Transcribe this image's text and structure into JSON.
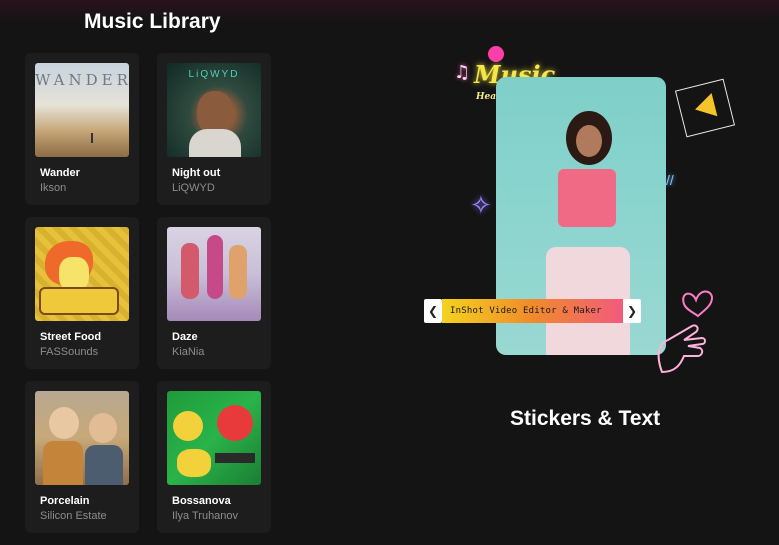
{
  "music_library": {
    "title": "Music Library",
    "tracks": [
      {
        "name": "Wander",
        "artist": "Ikson",
        "art_text": "WANDER"
      },
      {
        "name": "Night out",
        "artist": "LiQWYD",
        "art_text": "LiQWYD"
      },
      {
        "name": "Street Food",
        "artist": "FASSounds"
      },
      {
        "name": "Daze",
        "artist": "KiaNia"
      },
      {
        "name": "Porcelain",
        "artist": "Silicon Estate"
      },
      {
        "name": "Bossanova",
        "artist": "Ilya Truhanov"
      }
    ]
  },
  "promo": {
    "music_sticker_title": "Music",
    "music_sticker_subtitle": "Heal Your Soul",
    "text_sticker_label": "InShot Video Editor & Maker",
    "arrow_left": "❮",
    "arrow_right": "❯"
  },
  "stickers_section": {
    "title": "Stickers & Text"
  }
}
